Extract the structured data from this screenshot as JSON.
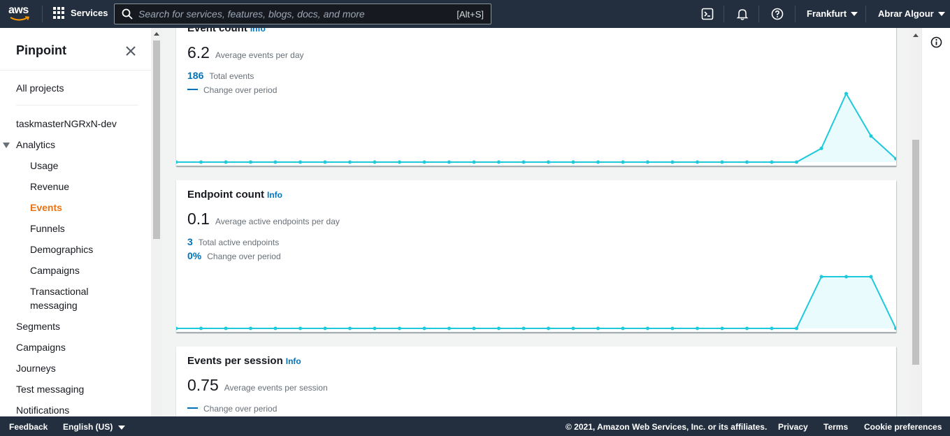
{
  "topnav": {
    "logo_text": "aws",
    "services_label": "Services",
    "search_placeholder": "Search for services, features, blogs, docs, and more",
    "search_shortcut": "[Alt+S]",
    "region": "Frankfurt",
    "user": "Abrar Algour",
    "icons": [
      "grid-icon",
      "search-icon",
      "cloudshell-icon",
      "bell-icon",
      "help-icon"
    ]
  },
  "sidebar": {
    "title": "Pinpoint",
    "all_projects": "All projects",
    "project": "taskmasterNGRxN-dev",
    "analytics": "Analytics",
    "analytics_items": [
      "Usage",
      "Revenue",
      "Events",
      "Funnels",
      "Demographics",
      "Campaigns",
      "Transactional",
      "messaging"
    ],
    "active_item": "Events",
    "items": [
      "Segments",
      "Campaigns",
      "Journeys",
      "Test messaging",
      "Notifications"
    ]
  },
  "cards": {
    "event_count": {
      "title": "Event count",
      "info": "Info",
      "value": "6.2",
      "value_label": "Average events per day",
      "total": "186",
      "total_label": "Total events",
      "change_label": "Change over period"
    },
    "endpoint_count": {
      "title": "Endpoint count",
      "info": "Info",
      "value": "0.1",
      "value_label": "Average active endpoints per day",
      "total": "3",
      "total_label": "Total active endpoints",
      "change": "0%",
      "change_label": "Change over period"
    },
    "events_per_session": {
      "title": "Events per session",
      "info": "Info",
      "value": "0.75",
      "value_label": "Average events per session",
      "change_label": "Change over period"
    }
  },
  "chart_data": [
    {
      "type": "area",
      "name": "Event count",
      "values": [
        0,
        0,
        0,
        0,
        0,
        0,
        0,
        0,
        0,
        0,
        0,
        0,
        0,
        0,
        0,
        0,
        0,
        0,
        0,
        0,
        0,
        0,
        0,
        0,
        0,
        0,
        0.2,
        1,
        0.38,
        0.05
      ],
      "color": "#1ec9db"
    },
    {
      "type": "area",
      "name": "Endpoint count",
      "values": [
        0,
        0,
        0,
        0,
        0,
        0,
        0,
        0,
        0,
        0,
        0,
        0,
        0,
        0,
        0,
        0,
        0,
        0,
        0,
        0,
        0,
        0,
        0,
        0,
        0,
        0,
        1,
        1,
        1,
        0
      ],
      "color": "#1ec9db"
    }
  ],
  "footer": {
    "feedback": "Feedback",
    "language": "English (US)",
    "copyright": "© 2021, Amazon Web Services, Inc. or its affiliates.",
    "privacy": "Privacy",
    "terms": "Terms",
    "cookies": "Cookie preferences"
  },
  "colors": {
    "nav_bg": "#232f3e",
    "active": "#ec7211",
    "link": "#0073bb",
    "chart_line": "#1ec9db"
  }
}
